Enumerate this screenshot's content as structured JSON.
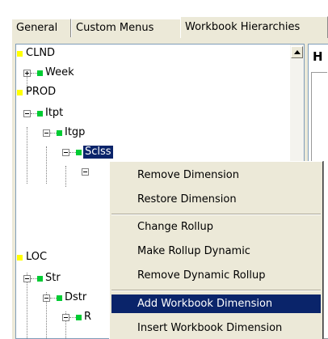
{
  "tabs": [
    {
      "label": "General",
      "active": false
    },
    {
      "label": "Custom Menus",
      "active": false
    },
    {
      "label": "Workbook Hierarchies",
      "active": true
    }
  ],
  "tree": {
    "nodes": [
      {
        "label": "CLND"
      },
      {
        "label": "Week"
      },
      {
        "label": "PROD"
      },
      {
        "label": "Itpt"
      },
      {
        "label": "Itgp"
      },
      {
        "label": "Sclss"
      },
      {
        "label": "LOC"
      },
      {
        "label": "Str"
      },
      {
        "label": "Dstr"
      },
      {
        "label": "R"
      }
    ]
  },
  "right_panel": {
    "title": "H"
  },
  "context_menu": {
    "items": [
      {
        "label": "Remove Dimension"
      },
      {
        "label": "Restore Dimension"
      },
      {
        "label": "Change Rollup"
      },
      {
        "label": "Make Rollup Dynamic"
      },
      {
        "label": "Remove Dynamic Rollup"
      },
      {
        "label": "Add Workbook Dimension",
        "highlighted": true
      },
      {
        "label": "Insert Workbook Dimension"
      }
    ]
  },
  "colors": {
    "dimension_marker": "#ffff00",
    "level_marker": "#00cc33",
    "menu_highlight": "#0a246a",
    "panel_background": "#ece9d8"
  }
}
